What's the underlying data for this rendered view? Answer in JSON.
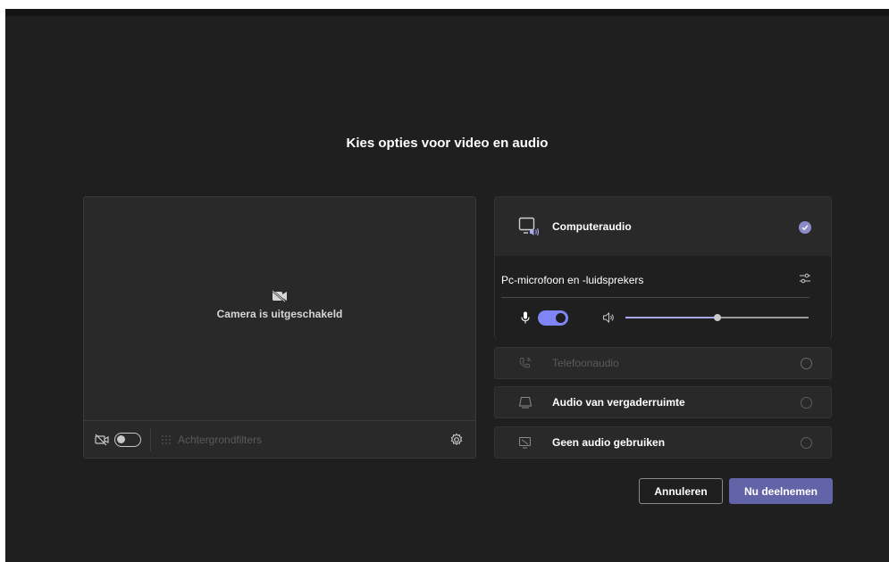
{
  "dialog": {
    "title": "Kies opties voor video en audio"
  },
  "video": {
    "camera_status": "Camera is uitgeschakeld",
    "camera_toggle_on": false,
    "background_filters_label": "Achtergrondfilters"
  },
  "audio": {
    "computer_audio": {
      "label": "Computeraudio",
      "selected": true,
      "device_label": "Pc-microfoon en -luidsprekers",
      "mic_enabled": true,
      "volume_level": 0.5
    },
    "options": [
      {
        "label": "Telefoonaudio",
        "enabled": false,
        "icon": "phone-icon"
      },
      {
        "label": "Audio van vergaderruimte",
        "enabled": true,
        "icon": "room-audio-icon"
      },
      {
        "label": "Geen audio gebruiken",
        "enabled": true,
        "icon": "no-audio-icon"
      }
    ]
  },
  "actions": {
    "cancel_label": "Annuleren",
    "join_label": "Nu deelnemen"
  },
  "colors": {
    "background": "#1f1f1f",
    "panel": "#292929",
    "accent": "#6264a7",
    "accent_light": "#7f85f5",
    "check": "#8b8cc7"
  }
}
